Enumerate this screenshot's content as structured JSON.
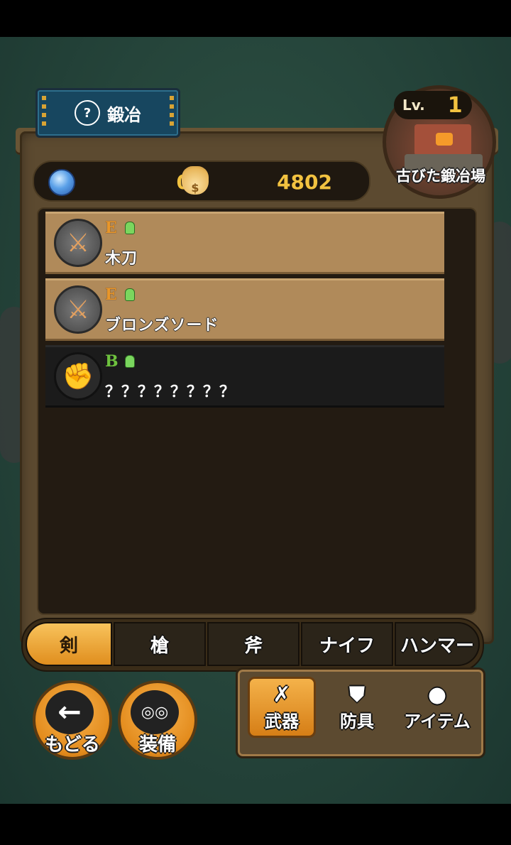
{
  "header": {
    "title": "鍛冶",
    "title_icon": "smith-icon"
  },
  "facility": {
    "level_label": "Lv.",
    "level": "1",
    "name": "古びた鍛冶場"
  },
  "currency": {
    "gems": "0",
    "coins": "4802",
    "bag_glyph": "$"
  },
  "items": [
    {
      "rank": "E",
      "name": "木刀",
      "icon": "wooden-sword-icon",
      "glyph": "⚔"
    },
    {
      "rank": "E",
      "name": "ブロンズソード",
      "icon": "bronze-sword-icon",
      "glyph": "⚔"
    },
    {
      "rank": "B",
      "name": "？？？？？？？？",
      "icon": "locked-weapon-icon",
      "glyph": "✊"
    }
  ],
  "categories": [
    {
      "label": "剣",
      "active": true
    },
    {
      "label": "槍",
      "active": false
    },
    {
      "label": "斧",
      "active": false
    },
    {
      "label": "ナイフ",
      "active": false
    },
    {
      "label": "ハンマー",
      "active": false
    }
  ],
  "buttons": {
    "back_label": "もどる",
    "back_glyph": "←",
    "equip_label": "装備",
    "equip_glyph": "◎◎"
  },
  "types": [
    {
      "label": "武器",
      "glyph": "✗",
      "active": true
    },
    {
      "label": "防具",
      "glyph": "⛊",
      "active": false
    },
    {
      "label": "アイテム",
      "glyph": "●",
      "active": false
    }
  ],
  "colors": {
    "accent": "#f2c240",
    "active_tab": "#e08e1e",
    "rank_e": "#e8962a",
    "rank_b": "#6ec23e"
  }
}
